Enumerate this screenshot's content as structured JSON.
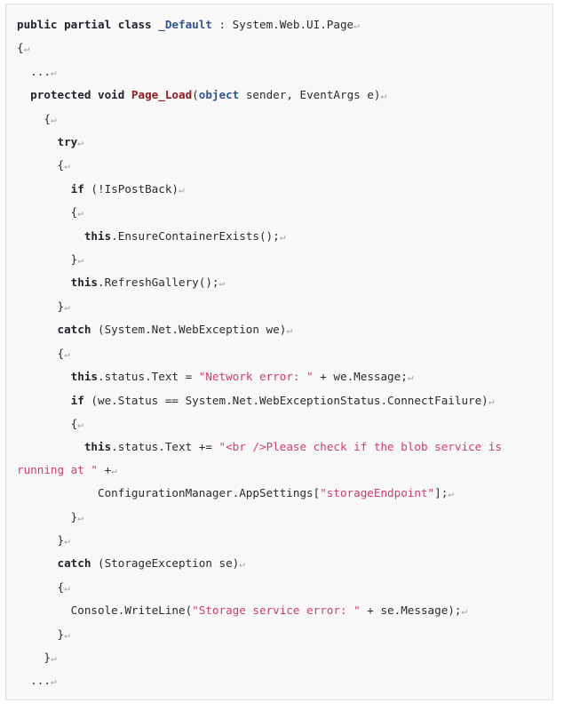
{
  "document": {
    "kind": "code-listing",
    "language": "C#",
    "background_color": "#f8f8f8",
    "border_color": "#e2e2e2",
    "return_glyph": "↵",
    "colors": {
      "keyword": "#20242b",
      "type": "#33558b",
      "function": "#8f1d20",
      "string": "#d13b6b",
      "plain": "#2b2b2b",
      "return_mark": "#9aa0a6"
    }
  },
  "code": {
    "lines": [
      {
        "indent": 0,
        "tokens": [
          {
            "t": "kw",
            "v": "public partial class "
          },
          {
            "t": "typ",
            "v": "_Default"
          },
          {
            "t": "pln",
            "v": " : System.Web.UI.Page"
          }
        ]
      },
      {
        "indent": 0,
        "tokens": [
          {
            "t": "pln",
            "v": "{"
          }
        ]
      },
      {
        "indent": 1,
        "tokens": [
          {
            "t": "pln",
            "v": "..."
          }
        ]
      },
      {
        "indent": 1,
        "tokens": [
          {
            "t": "kw",
            "v": "protected void "
          },
          {
            "t": "fn",
            "v": "Page_Load"
          },
          {
            "t": "pln",
            "v": "("
          },
          {
            "t": "typ",
            "v": "object"
          },
          {
            "t": "pln",
            "v": " sender, EventArgs e)"
          }
        ]
      },
      {
        "indent": 2,
        "tokens": [
          {
            "t": "pln",
            "v": "{"
          }
        ]
      },
      {
        "indent": 3,
        "tokens": [
          {
            "t": "kw",
            "v": "try"
          }
        ]
      },
      {
        "indent": 3,
        "tokens": [
          {
            "t": "pln",
            "v": "{"
          }
        ]
      },
      {
        "indent": 4,
        "tokens": [
          {
            "t": "kw",
            "v": "if"
          },
          {
            "t": "pln",
            "v": " (!IsPostBack)"
          }
        ]
      },
      {
        "indent": 4,
        "tokens": [
          {
            "t": "pln",
            "v": "{"
          }
        ]
      },
      {
        "indent": 5,
        "tokens": [
          {
            "t": "kw",
            "v": "this"
          },
          {
            "t": "pln",
            "v": ".EnsureContainerExists();"
          }
        ]
      },
      {
        "indent": 4,
        "tokens": [
          {
            "t": "pln",
            "v": "}"
          }
        ]
      },
      {
        "indent": 4,
        "tokens": [
          {
            "t": "kw",
            "v": "this"
          },
          {
            "t": "pln",
            "v": ".RefreshGallery();"
          }
        ]
      },
      {
        "indent": 3,
        "tokens": [
          {
            "t": "pln",
            "v": "}"
          }
        ]
      },
      {
        "indent": 3,
        "tokens": [
          {
            "t": "kw",
            "v": "catch"
          },
          {
            "t": "pln",
            "v": " (System.Net.WebException we)"
          }
        ]
      },
      {
        "indent": 3,
        "tokens": [
          {
            "t": "pln",
            "v": "{"
          }
        ]
      },
      {
        "indent": 4,
        "tokens": [
          {
            "t": "kw",
            "v": "this"
          },
          {
            "t": "pln",
            "v": ".status.Text = "
          },
          {
            "t": "str",
            "v": "\"Network error: \""
          },
          {
            "t": "pln",
            "v": " + we.Message;"
          }
        ]
      },
      {
        "indent": 4,
        "tokens": [
          {
            "t": "kw",
            "v": "if"
          },
          {
            "t": "pln",
            "v": " (we.Status == System.Net.WebExceptionStatus.ConnectFailure)"
          }
        ]
      },
      {
        "indent": 4,
        "tokens": [
          {
            "t": "pln",
            "v": "{"
          }
        ]
      },
      {
        "indent": 5,
        "tokens": [
          {
            "t": "kw",
            "v": "this"
          },
          {
            "t": "pln",
            "v": ".status.Text += "
          },
          {
            "t": "str",
            "v": "\"<br />Please check if the blob service is running at \""
          },
          {
            "t": "pln",
            "v": " +"
          }
        ]
      },
      {
        "indent": 6,
        "tokens": [
          {
            "t": "pln",
            "v": "ConfigurationManager.AppSettings["
          },
          {
            "t": "str",
            "v": "\"storageEndpoint\""
          },
          {
            "t": "pln",
            "v": "];"
          }
        ]
      },
      {
        "indent": 4,
        "tokens": [
          {
            "t": "pln",
            "v": "}"
          }
        ]
      },
      {
        "indent": 3,
        "tokens": [
          {
            "t": "pln",
            "v": "}"
          }
        ]
      },
      {
        "indent": 3,
        "tokens": [
          {
            "t": "kw",
            "v": "catch"
          },
          {
            "t": "pln",
            "v": " (StorageException se)"
          }
        ]
      },
      {
        "indent": 3,
        "tokens": [
          {
            "t": "pln",
            "v": "{"
          }
        ]
      },
      {
        "indent": 4,
        "tokens": [
          {
            "t": "pln",
            "v": "Console.WriteLine("
          },
          {
            "t": "str",
            "v": "\"Storage service error: \""
          },
          {
            "t": "pln",
            "v": " + se.Message);"
          }
        ]
      },
      {
        "indent": 3,
        "tokens": [
          {
            "t": "pln",
            "v": "}"
          }
        ]
      },
      {
        "indent": 2,
        "tokens": [
          {
            "t": "pln",
            "v": "}"
          }
        ]
      },
      {
        "indent": 1,
        "tokens": [
          {
            "t": "pln",
            "v": "..."
          }
        ]
      },
      {
        "indent": 0,
        "tokens": [
          {
            "t": "pln",
            "v": "}"
          }
        ]
      }
    ],
    "plain_text": "public partial class _Default : System.Web.UI.Page\n{\n  ...\n  protected void Page_Load(object sender, EventArgs e)\n   {\n    try\n    {\n      if (!IsPostBack)\n      {\n        this.EnsureContainerExists();\n      }\n      this.RefreshGallery();\n    }\n    catch (System.Net.WebException we)\n    {\n      this.status.Text = \"Network error: \" + we.Message;\n      if (we.Status == System.Net.WebExceptionStatus.ConnectFailure)\n      {\n        this.status.Text += \"<br />Please check if the blob service is running at \" +\n          ConfigurationManager.AppSettings[\"storageEndpoint\"];\n      }\n    }\n    catch (StorageException se)\n    {\n      Console.WriteLine(\"Storage service error: \" + se.Message);\n    }\n   }\n  ...\n}"
  }
}
